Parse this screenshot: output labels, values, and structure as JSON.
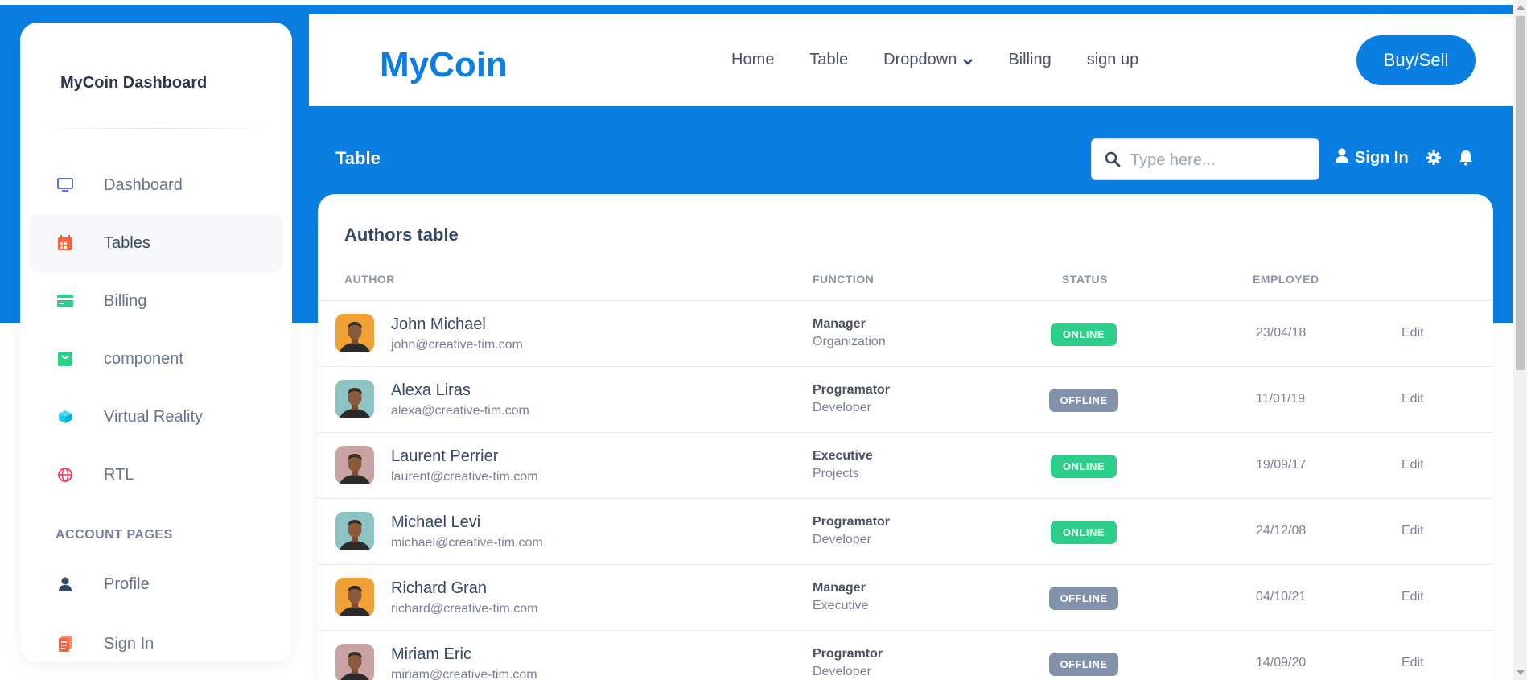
{
  "sidebar": {
    "brand": "MyCoin Dashboard",
    "items": [
      {
        "label": "Dashboard",
        "icon": "monitor-icon",
        "color": "#5e72e4",
        "active": false
      },
      {
        "label": "Tables",
        "icon": "calendar-icon",
        "color": "#fb6340",
        "active": true
      },
      {
        "label": "Billing",
        "icon": "credit-card-icon",
        "color": "#2dce89",
        "active": false
      },
      {
        "label": "component",
        "icon": "basket-icon",
        "color": "#2dce89",
        "active": false
      },
      {
        "label": "Virtual Reality",
        "icon": "cube-icon",
        "color": "#11cdef",
        "active": false
      },
      {
        "label": "RTL",
        "icon": "globe-icon",
        "color": "#f5365c",
        "active": false
      }
    ],
    "account_section_title": "ACCOUNT PAGES",
    "account_items": [
      {
        "label": "Profile",
        "icon": "user-icon",
        "color": "#344767"
      },
      {
        "label": "Sign In",
        "icon": "document-icon",
        "color": "#fb6340"
      }
    ]
  },
  "navbar": {
    "logo": "MyCoin",
    "links": [
      "Home",
      "Table",
      "Dropdown",
      "Billing",
      "sign up"
    ],
    "cta": "Buy/Sell"
  },
  "header": {
    "title": "Table",
    "search_placeholder": "Type here...",
    "sign_in": "Sign In"
  },
  "table": {
    "title": "Authors table",
    "columns": {
      "author": "AUTHOR",
      "function": "FUNCTION",
      "status": "STATUS",
      "employed": "EMPLOYED"
    },
    "edit_label": "Edit",
    "rows": [
      {
        "name": "John Michael",
        "email": "john@creative-tim.com",
        "function": "Manager",
        "function_sub": "Organization",
        "status": "ONLINE",
        "employed": "23/04/18",
        "avatar_bg": "#f0a034"
      },
      {
        "name": "Alexa Liras",
        "email": "alexa@creative-tim.com",
        "function": "Programator",
        "function_sub": "Developer",
        "status": "OFFLINE",
        "employed": "11/01/19",
        "avatar_bg": "#8ec3c4"
      },
      {
        "name": "Laurent Perrier",
        "email": "laurent@creative-tim.com",
        "function": "Executive",
        "function_sub": "Projects",
        "status": "ONLINE",
        "employed": "19/09/17",
        "avatar_bg": "#c9a3a3"
      },
      {
        "name": "Michael Levi",
        "email": "michael@creative-tim.com",
        "function": "Programator",
        "function_sub": "Developer",
        "status": "ONLINE",
        "employed": "24/12/08",
        "avatar_bg": "#8ec3c4"
      },
      {
        "name": "Richard Gran",
        "email": "richard@creative-tim.com",
        "function": "Manager",
        "function_sub": "Executive",
        "status": "OFFLINE",
        "employed": "04/10/21",
        "avatar_bg": "#f0a034"
      },
      {
        "name": "Miriam Eric",
        "email": "miriam@creative-tim.com",
        "function": "Programtor",
        "function_sub": "Developer",
        "status": "OFFLINE",
        "employed": "14/09/20",
        "avatar_bg": "#c9a3a3"
      }
    ]
  },
  "colors": {
    "primary": "#0b7ee1",
    "online": "#2dce89",
    "offline": "#8392ab"
  }
}
